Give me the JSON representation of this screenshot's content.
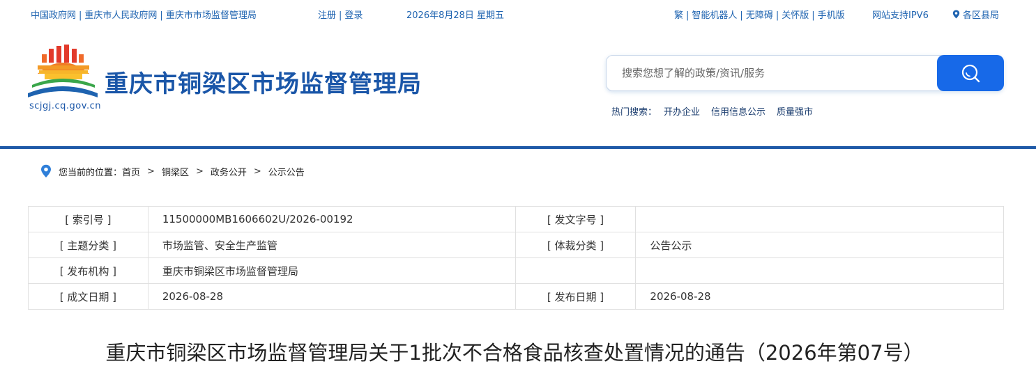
{
  "topbar": {
    "links_left": [
      "中国政府网",
      "重庆市人民政府网",
      "重庆市市场监督管理局"
    ],
    "register": "注册",
    "login": "登录",
    "date": "2026年8月28日  星期五",
    "links_right": [
      "繁",
      "智能机器人",
      "无障碍",
      "关怀版",
      "手机版"
    ],
    "ipv6": "网站支持IPV6",
    "districts": "各区县局"
  },
  "header": {
    "title": "重庆市铜梁区市场监督管理局",
    "domain": "scjgj.cq.gov.cn"
  },
  "search": {
    "placeholder": "搜索您想了解的政策/资讯/服务",
    "hot_label": "热门搜索：",
    "hot_items": [
      "开办企业",
      "信用信息公示",
      "质量强市"
    ]
  },
  "breadcrumb": {
    "label": "您当前的位置：",
    "items": [
      "首页",
      "铜梁区",
      "政务公开",
      "公示公告"
    ],
    "separator": ">"
  },
  "info": {
    "rows": [
      {
        "k1": "[ 索引号 ]",
        "v1": "11500000MB1606602U/2026-00192",
        "k2": "[ 发文字号 ]",
        "v2": ""
      },
      {
        "k1": "[ 主题分类 ]",
        "v1": "市场监管、安全生产监管",
        "k2": "[ 体裁分类 ]",
        "v2": "公告公示"
      },
      {
        "k1": "[ 发布机构 ]",
        "v1": "重庆市铜梁区市场监督管理局",
        "k2": "",
        "v2": ""
      },
      {
        "k1": "[ 成文日期 ]",
        "v1": "2026-08-28",
        "k2": "[ 发布日期 ]",
        "v2": "2026-08-28"
      }
    ]
  },
  "article": {
    "title": "重庆市铜梁区市场监督管理局关于1批次不合格食品核查处置情况的通告（2026年第07号）"
  },
  "colors": {
    "brand_blue": "#1a56a8",
    "link_blue": "#1e63b0",
    "search_button": "#1769e8",
    "divider": "#1f5aa8"
  },
  "icons": [
    "emblem-logo-icon",
    "search-icon",
    "location-pin-icon"
  ]
}
